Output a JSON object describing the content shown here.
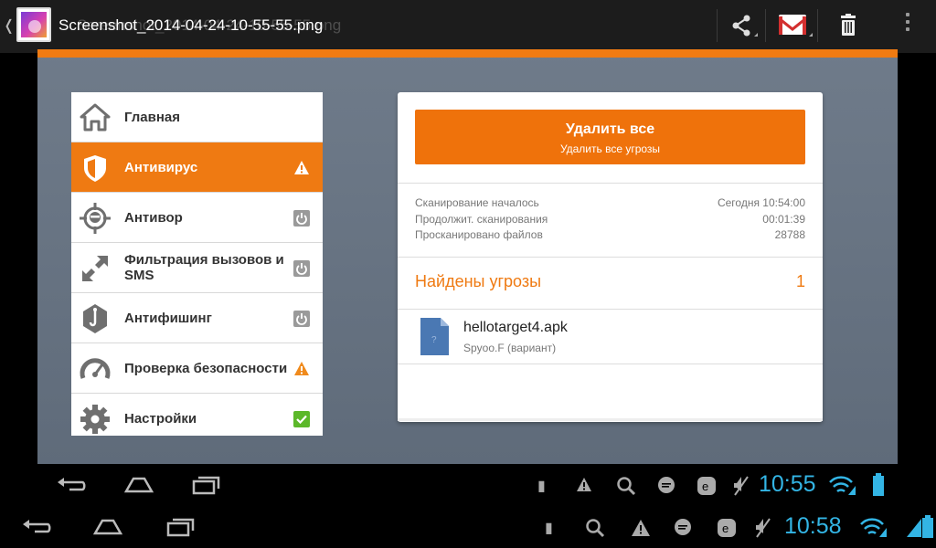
{
  "header": {
    "title": "Screenshot_2014-04-24-10-55-55.png",
    "ghost_title": "Screenshot_2014-04-24-10-55-55.png"
  },
  "menu": {
    "items": [
      {
        "label": "Главная",
        "icon": "home-icon",
        "status": ""
      },
      {
        "label": "Антивирус",
        "icon": "shield-icon",
        "status": "warning"
      },
      {
        "label": "Антивор",
        "icon": "thief-icon",
        "status": "power"
      },
      {
        "label": "Фильтрация вызовов и SMS",
        "icon": "call-filter-icon",
        "status": "power"
      },
      {
        "label": "Антифишинг",
        "icon": "hook-icon",
        "status": "power"
      },
      {
        "label": "Проверка безопасности",
        "icon": "gauge-icon",
        "status": "warning"
      },
      {
        "label": "Настройки",
        "icon": "gear-icon",
        "status": "check"
      }
    ]
  },
  "panel": {
    "delete_title": "Удалить все",
    "delete_subtitle": "Удалить все угрозы",
    "stats": [
      {
        "label": "Сканирование началось",
        "value": "Сегодня 10:54:00"
      },
      {
        "label": "Продолжит. сканирования",
        "value": "00:01:39"
      },
      {
        "label": "Просканировано файлов",
        "value": "28788"
      }
    ],
    "threats_label": "Найдены угрозы",
    "threats_count": "1",
    "threat": {
      "name": "hellotarget4.apk",
      "detail": "Spyoo.F (вариант)"
    }
  },
  "status": {
    "time_top": "10:55",
    "time_bottom": "10:58"
  },
  "colors": {
    "accent": "#ef7a12",
    "clock": "#33b5e5"
  }
}
